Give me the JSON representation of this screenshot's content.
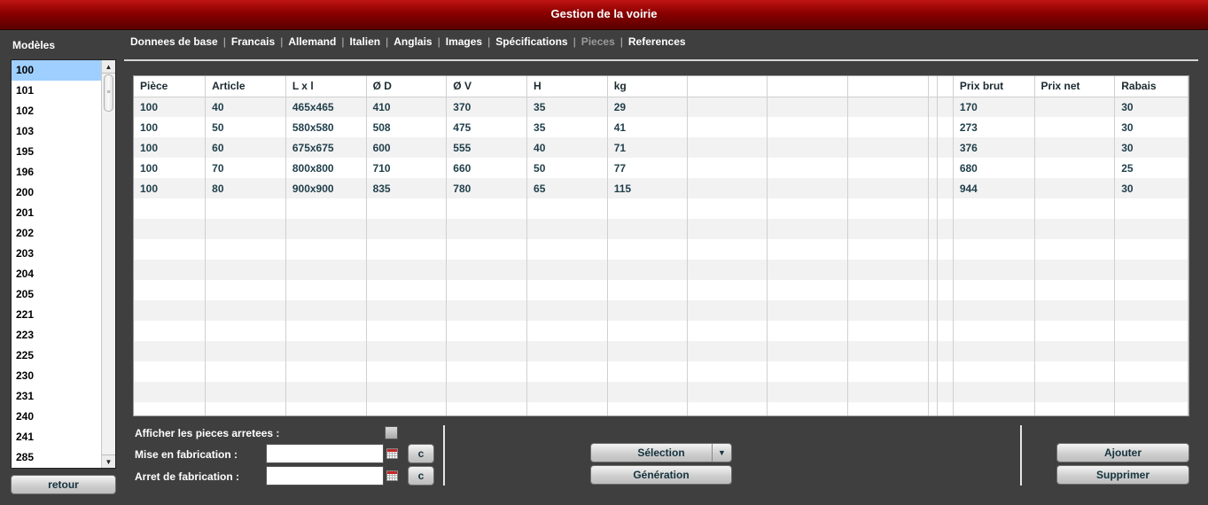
{
  "window": {
    "title": "Gestion de la voirie"
  },
  "sidebar": {
    "label": "Modèles",
    "selected": "100",
    "items": [
      "100",
      "101",
      "102",
      "103",
      "195",
      "196",
      "200",
      "201",
      "202",
      "203",
      "204",
      "205",
      "221",
      "223",
      "225",
      "230",
      "231",
      "240",
      "241",
      "285"
    ],
    "back_label": "retour"
  },
  "tabs": [
    {
      "label": "Donnees de base",
      "active": false
    },
    {
      "label": "Francais",
      "active": false
    },
    {
      "label": "Allemand",
      "active": false
    },
    {
      "label": "Italien",
      "active": false
    },
    {
      "label": "Anglais",
      "active": false
    },
    {
      "label": "Images",
      "active": false
    },
    {
      "label": "Spécifications",
      "active": false
    },
    {
      "label": "Pieces",
      "active": true
    },
    {
      "label": "References",
      "active": false
    }
  ],
  "table": {
    "columns": [
      "Pièce",
      "Article",
      "L x l",
      "Ø D",
      "Ø V",
      "H",
      "kg",
      "",
      "",
      "",
      "",
      "",
      "Prix brut",
      "Prix net",
      "Rabais"
    ],
    "rows": [
      [
        "100",
        "40",
        "465x465",
        "410",
        "370",
        "35",
        "29",
        "",
        "",
        "",
        "",
        "",
        "170",
        "",
        "30"
      ],
      [
        "100",
        "50",
        "580x580",
        "508",
        "475",
        "35",
        "41",
        "",
        "",
        "",
        "",
        "",
        "273",
        "",
        "30"
      ],
      [
        "100",
        "60",
        "675x675",
        "600",
        "555",
        "40",
        "71",
        "",
        "",
        "",
        "",
        "",
        "376",
        "",
        "30"
      ],
      [
        "100",
        "70",
        "800x800",
        "710",
        "660",
        "50",
        "77",
        "",
        "",
        "",
        "",
        "",
        "680",
        "",
        "25"
      ],
      [
        "100",
        "80",
        "900x900",
        "835",
        "780",
        "65",
        "115",
        "",
        "",
        "",
        "",
        "",
        "944",
        "",
        "30"
      ]
    ],
    "visible_row_count": 16
  },
  "options": {
    "show_stopped_label": "Afficher les pieces arretees :",
    "show_stopped_checked": false,
    "production_start_label": "Mise en fabrication :",
    "production_start_value": "",
    "production_end_label": "Arret de fabrication :",
    "production_end_value": "",
    "clear_label": "c"
  },
  "actions": {
    "selection_label": "Sélection",
    "generation_label": "Génération",
    "add_label": "Ajouter",
    "delete_label": "Supprimer"
  }
}
